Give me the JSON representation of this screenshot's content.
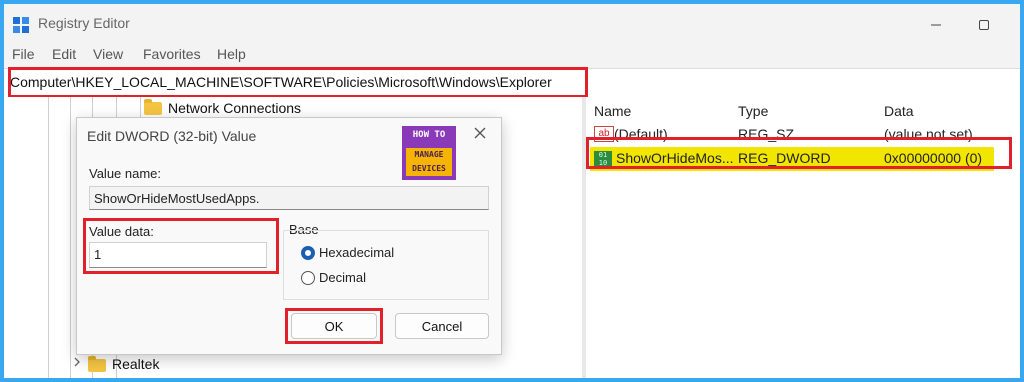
{
  "window": {
    "title": "Registry Editor",
    "icons": {
      "app": "registry-editor-icon",
      "minimize": "minimize-icon",
      "maximize": "maximize-icon"
    }
  },
  "menu": [
    "File",
    "Edit",
    "View",
    "Favorites",
    "Help"
  ],
  "address": {
    "path": "Computer\\HKEY_LOCAL_MACHINE\\SOFTWARE\\Policies\\Microsoft\\Windows\\Explorer"
  },
  "tree": {
    "items": [
      {
        "label": "Network Connections"
      },
      {
        "label": "Realtek"
      }
    ]
  },
  "list": {
    "columns": [
      "Name",
      "Type",
      "Data"
    ],
    "rows": [
      {
        "icon": "string-value-icon",
        "name": "(Default)",
        "type": "REG_SZ",
        "data": "(value not set)"
      },
      {
        "icon": "dword-value-icon",
        "name": "ShowOrHideMos...",
        "type": "REG_DWORD",
        "data": "0x00000000 (0)",
        "highlight": "#f2e600"
      }
    ]
  },
  "dialog": {
    "title": "Edit DWORD (32-bit) Value",
    "value_name_label": "Value name:",
    "value_name": "ShowOrHideMostUsedApps.",
    "value_data_label": "Value data:",
    "value_data": "1",
    "base_label": "Base",
    "base_options": [
      {
        "label": "Hexadecimal",
        "selected": true
      },
      {
        "label": "Decimal",
        "selected": false
      }
    ],
    "ok_label": "OK",
    "cancel_label": "Cancel"
  },
  "logo": {
    "top_text": "HOW TO",
    "bottom_line1": "MANAGE",
    "bottom_line2": "DEVICES"
  },
  "colors": {
    "highlight_box": "#e0202a",
    "row_highlight": "#f2e600",
    "background_frame": "#3aa8f0",
    "logo_purple": "#8a3ab9",
    "logo_orange": "#f4b400"
  }
}
